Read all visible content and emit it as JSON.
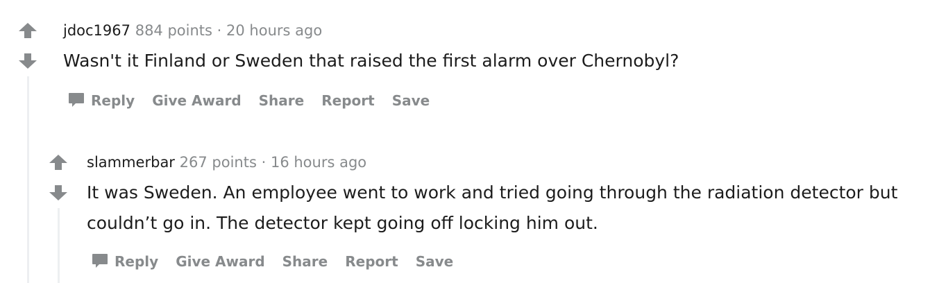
{
  "comments": [
    {
      "author": "jdoc1967",
      "points": "884 points",
      "separator": "·",
      "time": "20 hours ago",
      "body": "Wasn't it Finland or Sweden that raised the first alarm over Chernobyl?",
      "actions": {
        "reply": "Reply",
        "give_award": "Give Award",
        "share": "Share",
        "report": "Report",
        "save": "Save"
      }
    },
    {
      "author": "slammerbar",
      "points": "267 points",
      "separator": "·",
      "time": "16 hours ago",
      "body": "It was Sweden. An employee went to work and tried going through the radiation detector but couldn’t go in. The detector kept going off locking him out.",
      "actions": {
        "reply": "Reply",
        "give_award": "Give Award",
        "share": "Share",
        "report": "Report",
        "save": "Save"
      }
    }
  ],
  "icons": {
    "upvote": "upvote-arrow-icon",
    "downvote": "downvote-arrow-icon",
    "reply": "speech-bubble-icon"
  },
  "colors": {
    "text": "#1c1c1c",
    "muted": "#878a8c",
    "arrow": "#878a8c",
    "thread_line": "#edeff1"
  }
}
